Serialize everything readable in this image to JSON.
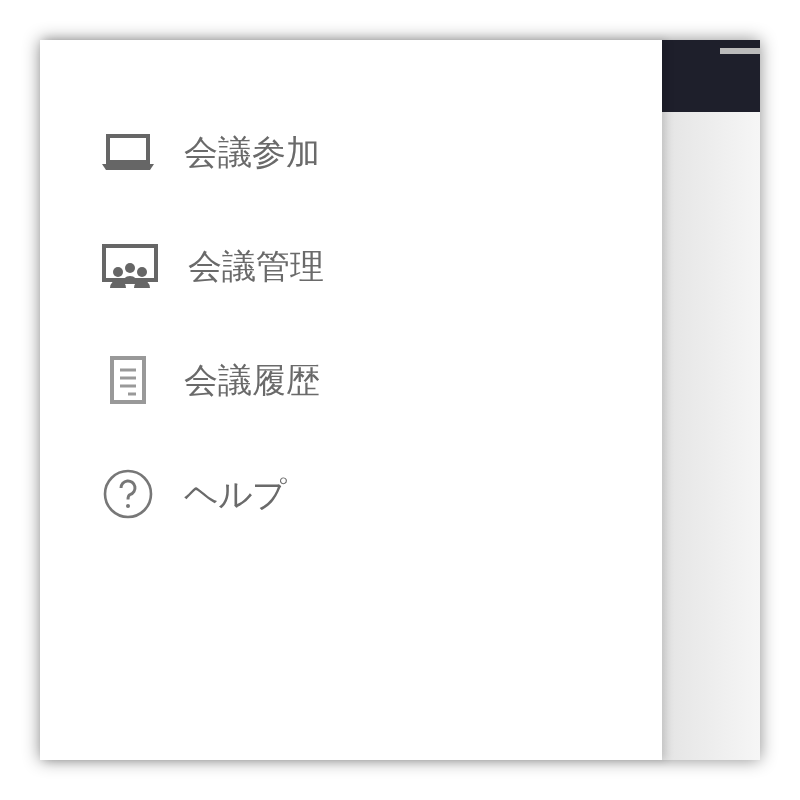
{
  "menu": [
    {
      "label": "会議参加",
      "kind": "laptop"
    },
    {
      "label": "会議管理",
      "kind": "meeting"
    },
    {
      "label": "会議履歴",
      "kind": "document"
    },
    {
      "label": "ヘルプ",
      "kind": "help"
    }
  ]
}
